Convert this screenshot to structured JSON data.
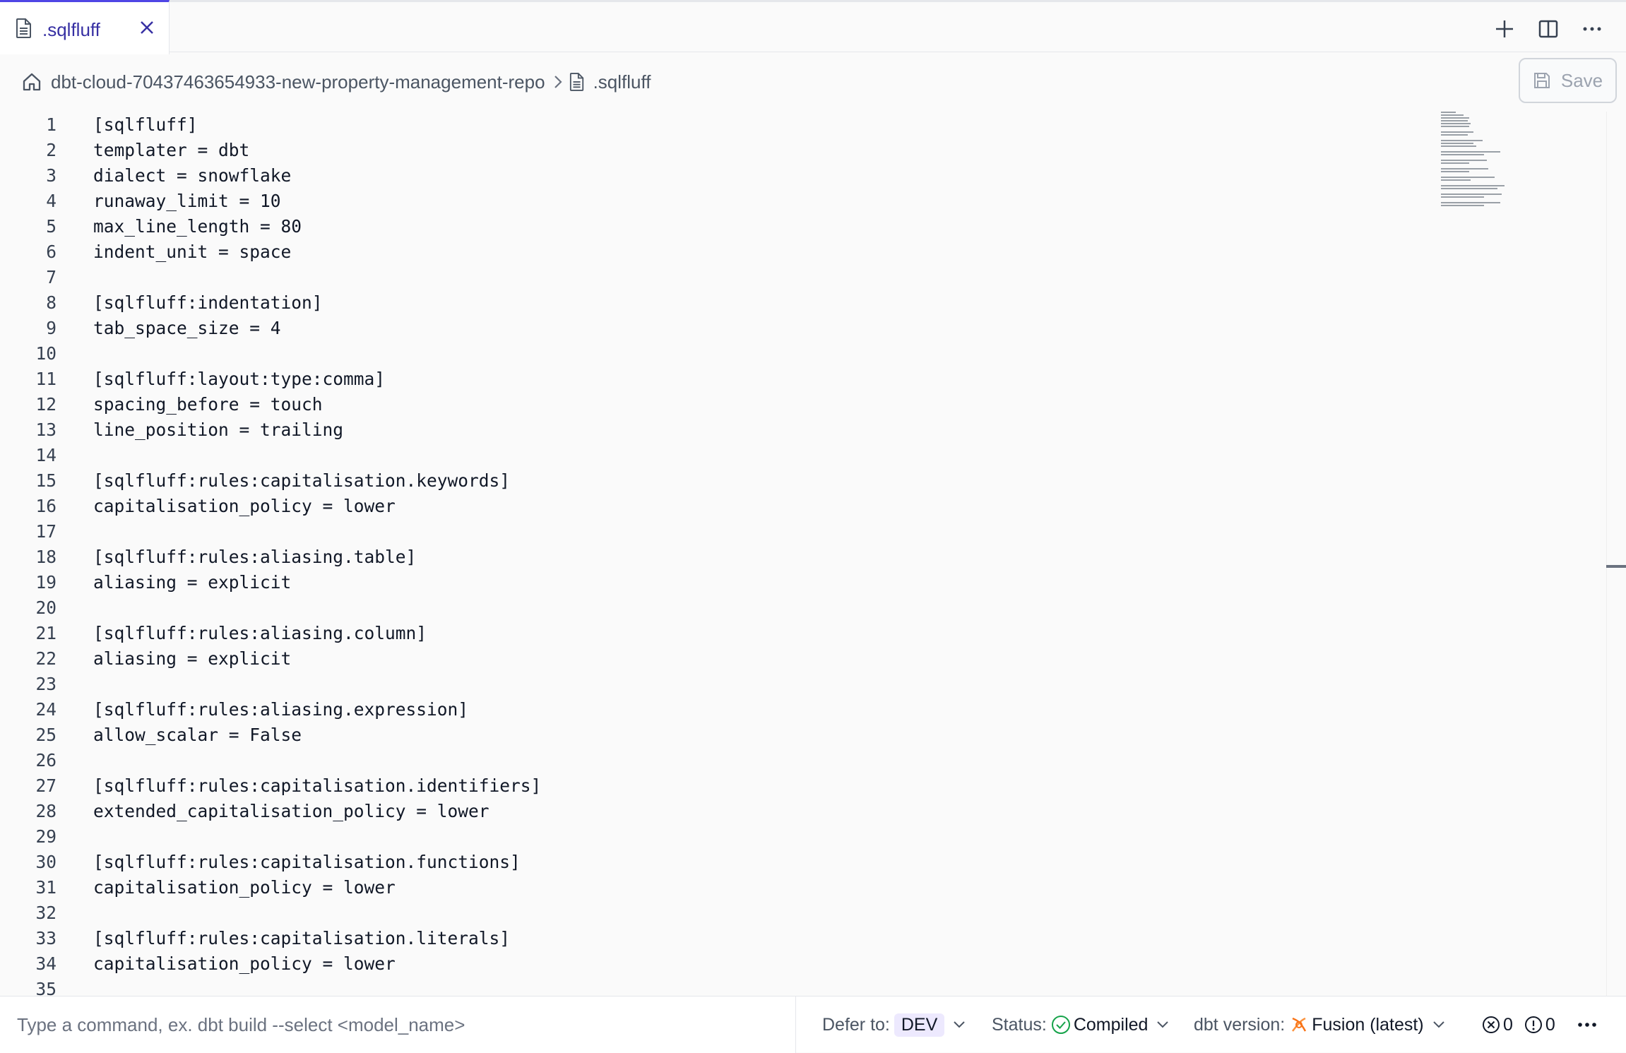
{
  "tab": {
    "label": ".sqlfluff"
  },
  "breadcrumb": {
    "repo": "dbt-cloud-70437463654933-new-property-management-repo",
    "file": ".sqlfluff"
  },
  "toolbar": {
    "save_label": "Save"
  },
  "editor": {
    "lines": [
      {
        "num": "1",
        "text": "[sqlfluff]"
      },
      {
        "num": "2",
        "text": "templater = dbt"
      },
      {
        "num": "3",
        "text": "dialect = snowflake"
      },
      {
        "num": "4",
        "text": "runaway_limit = 10"
      },
      {
        "num": "5",
        "text": "max_line_length = 80"
      },
      {
        "num": "6",
        "text": "indent_unit = space"
      },
      {
        "num": "7",
        "text": ""
      },
      {
        "num": "8",
        "text": "[sqlfluff:indentation]"
      },
      {
        "num": "9",
        "text": "tab_space_size = 4"
      },
      {
        "num": "10",
        "text": ""
      },
      {
        "num": "11",
        "text": "[sqlfluff:layout:type:comma]"
      },
      {
        "num": "12",
        "text": "spacing_before = touch"
      },
      {
        "num": "13",
        "text": "line_position = trailing"
      },
      {
        "num": "14",
        "text": ""
      },
      {
        "num": "15",
        "text": "[sqlfluff:rules:capitalisation.keywords]"
      },
      {
        "num": "16",
        "text": "capitalisation_policy = lower"
      },
      {
        "num": "17",
        "text": ""
      },
      {
        "num": "18",
        "text": "[sqlfluff:rules:aliasing.table]"
      },
      {
        "num": "19",
        "text": "aliasing = explicit"
      },
      {
        "num": "20",
        "text": ""
      },
      {
        "num": "21",
        "text": "[sqlfluff:rules:aliasing.column]"
      },
      {
        "num": "22",
        "text": "aliasing = explicit"
      },
      {
        "num": "23",
        "text": ""
      },
      {
        "num": "24",
        "text": "[sqlfluff:rules:aliasing.expression]"
      },
      {
        "num": "25",
        "text": "allow_scalar = False"
      },
      {
        "num": "26",
        "text": ""
      },
      {
        "num": "27",
        "text": "[sqlfluff:rules:capitalisation.identifiers]"
      },
      {
        "num": "28",
        "text": "extended_capitalisation_policy = lower"
      },
      {
        "num": "29",
        "text": ""
      },
      {
        "num": "30",
        "text": "[sqlfluff:rules:capitalisation.functions]"
      },
      {
        "num": "31",
        "text": "capitalisation_policy = lower"
      },
      {
        "num": "32",
        "text": ""
      },
      {
        "num": "33",
        "text": "[sqlfluff:rules:capitalisation.literals]"
      },
      {
        "num": "34",
        "text": "capitalisation_policy = lower"
      },
      {
        "num": "35",
        "text": ""
      }
    ]
  },
  "statusbar": {
    "command_placeholder": "Type a command, ex. dbt build --select <model_name>",
    "defer_label": "Defer to:",
    "defer_value": "DEV",
    "status_label": "Status:",
    "status_value": "Compiled",
    "version_label": "dbt version:",
    "version_value": "Fusion (latest)",
    "errors_count": "0",
    "warnings_count": "0"
  },
  "colors": {
    "accent": "#4f46e5",
    "success": "#16a34a",
    "fusion": "#f97316"
  }
}
